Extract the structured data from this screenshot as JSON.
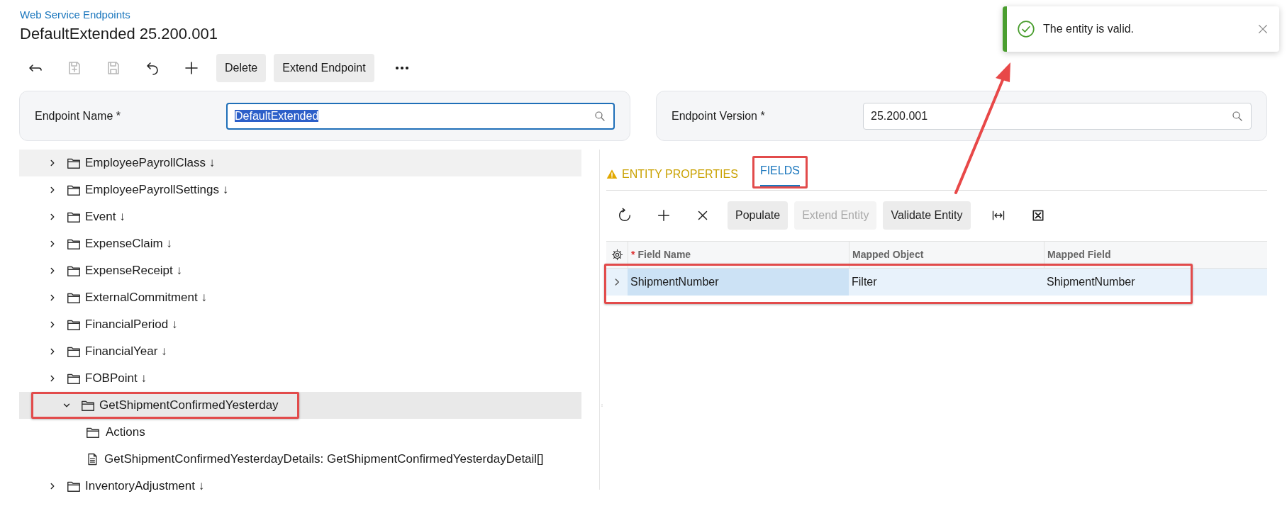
{
  "breadcrumb": "Web Service Endpoints",
  "title": "DefaultExtended 25.200.001",
  "toolbar": {
    "icon_buttons": [
      {
        "disabled": false
      },
      {
        "disabled": true
      },
      {
        "disabled": true
      },
      {
        "disabled": false
      },
      {
        "disabled": false
      }
    ],
    "buttons": [
      {
        "label": "Delete"
      },
      {
        "label": "Extend Endpoint"
      }
    ]
  },
  "header_fields": [
    {
      "label": "Endpoint Name *",
      "value": "DefaultExtended",
      "focused": true,
      "text_selected": true
    },
    {
      "label": "Endpoint Version *",
      "value": "25.200.001",
      "focused": false,
      "text_selected": false
    }
  ],
  "tree": {
    "items": [
      {
        "label": "EmployeePayrollClass",
        "marker": "↓",
        "expanded": false,
        "selected": false,
        "hovered": true,
        "callout": false
      },
      {
        "label": "EmployeePayrollSettings",
        "marker": "↓",
        "expanded": false,
        "selected": false,
        "hovered": false,
        "callout": false
      },
      {
        "label": "Event",
        "marker": "↓",
        "expanded": false,
        "selected": false,
        "hovered": false,
        "callout": false
      },
      {
        "label": "ExpenseClaim",
        "marker": "↓",
        "expanded": false,
        "selected": false,
        "hovered": false,
        "callout": false
      },
      {
        "label": "ExpenseReceipt",
        "marker": "↓",
        "expanded": false,
        "selected": false,
        "hovered": false,
        "callout": false
      },
      {
        "label": "ExternalCommitment",
        "marker": "↓",
        "expanded": false,
        "selected": false,
        "hovered": false,
        "callout": false
      },
      {
        "label": "FinancialPeriod",
        "marker": "↓",
        "expanded": false,
        "selected": false,
        "hovered": false,
        "callout": false
      },
      {
        "label": "FinancialYear",
        "marker": "↓",
        "expanded": false,
        "selected": false,
        "hovered": false,
        "callout": false
      },
      {
        "label": "FOBPoint",
        "marker": "↓",
        "expanded": false,
        "selected": false,
        "hovered": false,
        "callout": false
      },
      {
        "label": "GetShipmentConfirmedYesterday",
        "expanded": true,
        "selected": true,
        "hovered": false,
        "callout": true,
        "children": [
          {
            "kind": "folder",
            "label": "Actions"
          },
          {
            "kind": "document",
            "label": "GetShipmentConfirmedYesterdayDetails: GetShipmentConfirmedYesterdayDetail[]"
          }
        ]
      },
      {
        "label": "InventoryAdjustment",
        "marker": "↓",
        "expanded": false,
        "selected": false,
        "hovered": false,
        "callout": false
      }
    ]
  },
  "tabs": [
    {
      "label": "ENTITY PROPERTIES",
      "selected": false,
      "warning": true,
      "callout": false
    },
    {
      "label": "FIELDS",
      "selected": true,
      "warning": false,
      "callout": true
    }
  ],
  "grid_toolbar": {
    "buttons": [
      {
        "label": "Populate",
        "disabled": false
      },
      {
        "label": "Extend Entity",
        "disabled": true
      },
      {
        "label": "Validate Entity",
        "disabled": false
      }
    ]
  },
  "grid": {
    "columns": [
      {
        "label": "Field Name",
        "required_mark": "*"
      },
      {
        "label": "Mapped Object"
      },
      {
        "label": "Mapped Field"
      }
    ],
    "rows": [
      {
        "cells": [
          "ShipmentNumber",
          "Filter",
          "ShipmentNumber"
        ],
        "selected": true,
        "callout": true
      }
    ]
  },
  "toast": {
    "kind": "success",
    "message": "The entity is valid."
  },
  "annotation_arrow": true
}
